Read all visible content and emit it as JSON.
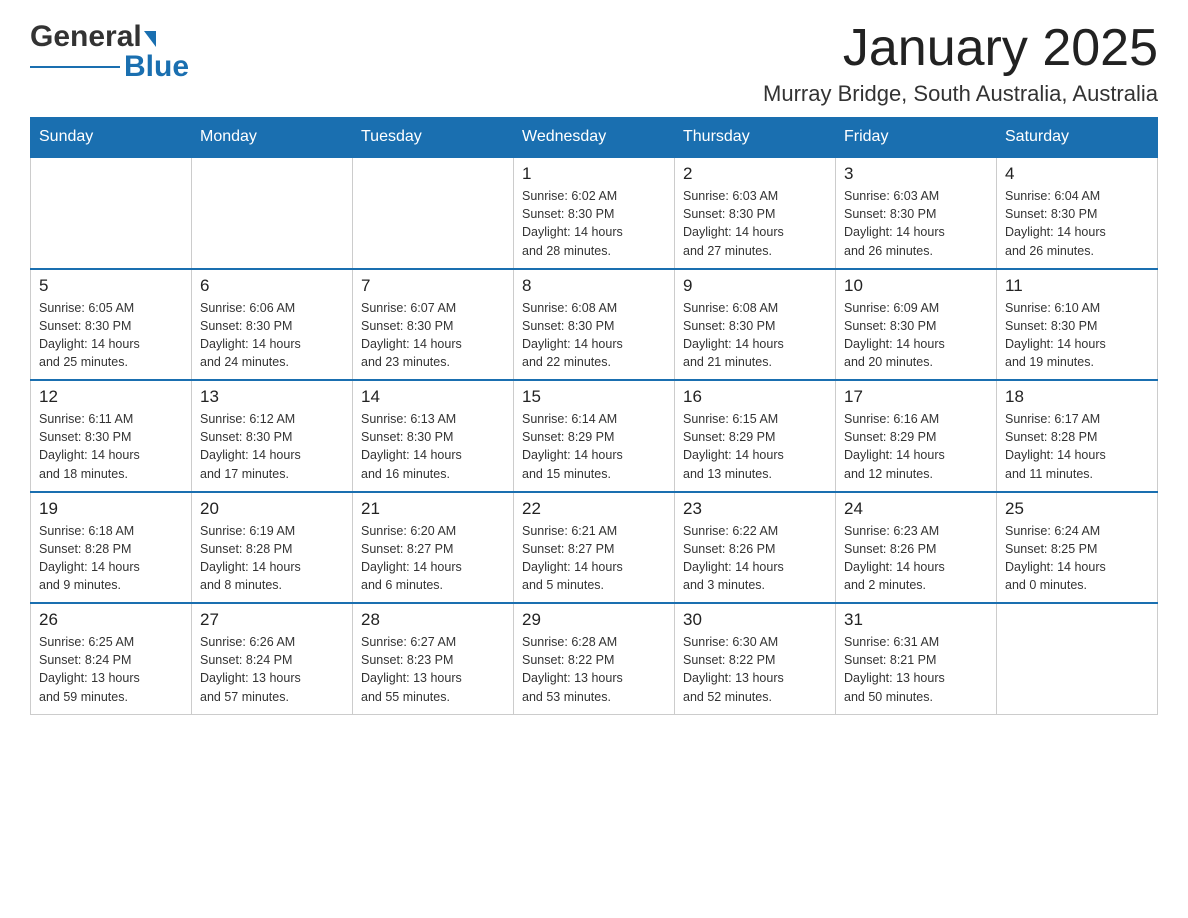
{
  "header": {
    "logo_text_black": "General",
    "logo_text_blue": "Blue",
    "month_title": "January 2025",
    "location": "Murray Bridge, South Australia, Australia"
  },
  "days_of_week": [
    "Sunday",
    "Monday",
    "Tuesday",
    "Wednesday",
    "Thursday",
    "Friday",
    "Saturday"
  ],
  "weeks": [
    [
      {
        "day": "",
        "info": ""
      },
      {
        "day": "",
        "info": ""
      },
      {
        "day": "",
        "info": ""
      },
      {
        "day": "1",
        "info": "Sunrise: 6:02 AM\nSunset: 8:30 PM\nDaylight: 14 hours\nand 28 minutes."
      },
      {
        "day": "2",
        "info": "Sunrise: 6:03 AM\nSunset: 8:30 PM\nDaylight: 14 hours\nand 27 minutes."
      },
      {
        "day": "3",
        "info": "Sunrise: 6:03 AM\nSunset: 8:30 PM\nDaylight: 14 hours\nand 26 minutes."
      },
      {
        "day": "4",
        "info": "Sunrise: 6:04 AM\nSunset: 8:30 PM\nDaylight: 14 hours\nand 26 minutes."
      }
    ],
    [
      {
        "day": "5",
        "info": "Sunrise: 6:05 AM\nSunset: 8:30 PM\nDaylight: 14 hours\nand 25 minutes."
      },
      {
        "day": "6",
        "info": "Sunrise: 6:06 AM\nSunset: 8:30 PM\nDaylight: 14 hours\nand 24 minutes."
      },
      {
        "day": "7",
        "info": "Sunrise: 6:07 AM\nSunset: 8:30 PM\nDaylight: 14 hours\nand 23 minutes."
      },
      {
        "day": "8",
        "info": "Sunrise: 6:08 AM\nSunset: 8:30 PM\nDaylight: 14 hours\nand 22 minutes."
      },
      {
        "day": "9",
        "info": "Sunrise: 6:08 AM\nSunset: 8:30 PM\nDaylight: 14 hours\nand 21 minutes."
      },
      {
        "day": "10",
        "info": "Sunrise: 6:09 AM\nSunset: 8:30 PM\nDaylight: 14 hours\nand 20 minutes."
      },
      {
        "day": "11",
        "info": "Sunrise: 6:10 AM\nSunset: 8:30 PM\nDaylight: 14 hours\nand 19 minutes."
      }
    ],
    [
      {
        "day": "12",
        "info": "Sunrise: 6:11 AM\nSunset: 8:30 PM\nDaylight: 14 hours\nand 18 minutes."
      },
      {
        "day": "13",
        "info": "Sunrise: 6:12 AM\nSunset: 8:30 PM\nDaylight: 14 hours\nand 17 minutes."
      },
      {
        "day": "14",
        "info": "Sunrise: 6:13 AM\nSunset: 8:30 PM\nDaylight: 14 hours\nand 16 minutes."
      },
      {
        "day": "15",
        "info": "Sunrise: 6:14 AM\nSunset: 8:29 PM\nDaylight: 14 hours\nand 15 minutes."
      },
      {
        "day": "16",
        "info": "Sunrise: 6:15 AM\nSunset: 8:29 PM\nDaylight: 14 hours\nand 13 minutes."
      },
      {
        "day": "17",
        "info": "Sunrise: 6:16 AM\nSunset: 8:29 PM\nDaylight: 14 hours\nand 12 minutes."
      },
      {
        "day": "18",
        "info": "Sunrise: 6:17 AM\nSunset: 8:28 PM\nDaylight: 14 hours\nand 11 minutes."
      }
    ],
    [
      {
        "day": "19",
        "info": "Sunrise: 6:18 AM\nSunset: 8:28 PM\nDaylight: 14 hours\nand 9 minutes."
      },
      {
        "day": "20",
        "info": "Sunrise: 6:19 AM\nSunset: 8:28 PM\nDaylight: 14 hours\nand 8 minutes."
      },
      {
        "day": "21",
        "info": "Sunrise: 6:20 AM\nSunset: 8:27 PM\nDaylight: 14 hours\nand 6 minutes."
      },
      {
        "day": "22",
        "info": "Sunrise: 6:21 AM\nSunset: 8:27 PM\nDaylight: 14 hours\nand 5 minutes."
      },
      {
        "day": "23",
        "info": "Sunrise: 6:22 AM\nSunset: 8:26 PM\nDaylight: 14 hours\nand 3 minutes."
      },
      {
        "day": "24",
        "info": "Sunrise: 6:23 AM\nSunset: 8:26 PM\nDaylight: 14 hours\nand 2 minutes."
      },
      {
        "day": "25",
        "info": "Sunrise: 6:24 AM\nSunset: 8:25 PM\nDaylight: 14 hours\nand 0 minutes."
      }
    ],
    [
      {
        "day": "26",
        "info": "Sunrise: 6:25 AM\nSunset: 8:24 PM\nDaylight: 13 hours\nand 59 minutes."
      },
      {
        "day": "27",
        "info": "Sunrise: 6:26 AM\nSunset: 8:24 PM\nDaylight: 13 hours\nand 57 minutes."
      },
      {
        "day": "28",
        "info": "Sunrise: 6:27 AM\nSunset: 8:23 PM\nDaylight: 13 hours\nand 55 minutes."
      },
      {
        "day": "29",
        "info": "Sunrise: 6:28 AM\nSunset: 8:22 PM\nDaylight: 13 hours\nand 53 minutes."
      },
      {
        "day": "30",
        "info": "Sunrise: 6:30 AM\nSunset: 8:22 PM\nDaylight: 13 hours\nand 52 minutes."
      },
      {
        "day": "31",
        "info": "Sunrise: 6:31 AM\nSunset: 8:21 PM\nDaylight: 13 hours\nand 50 minutes."
      },
      {
        "day": "",
        "info": ""
      }
    ]
  ]
}
